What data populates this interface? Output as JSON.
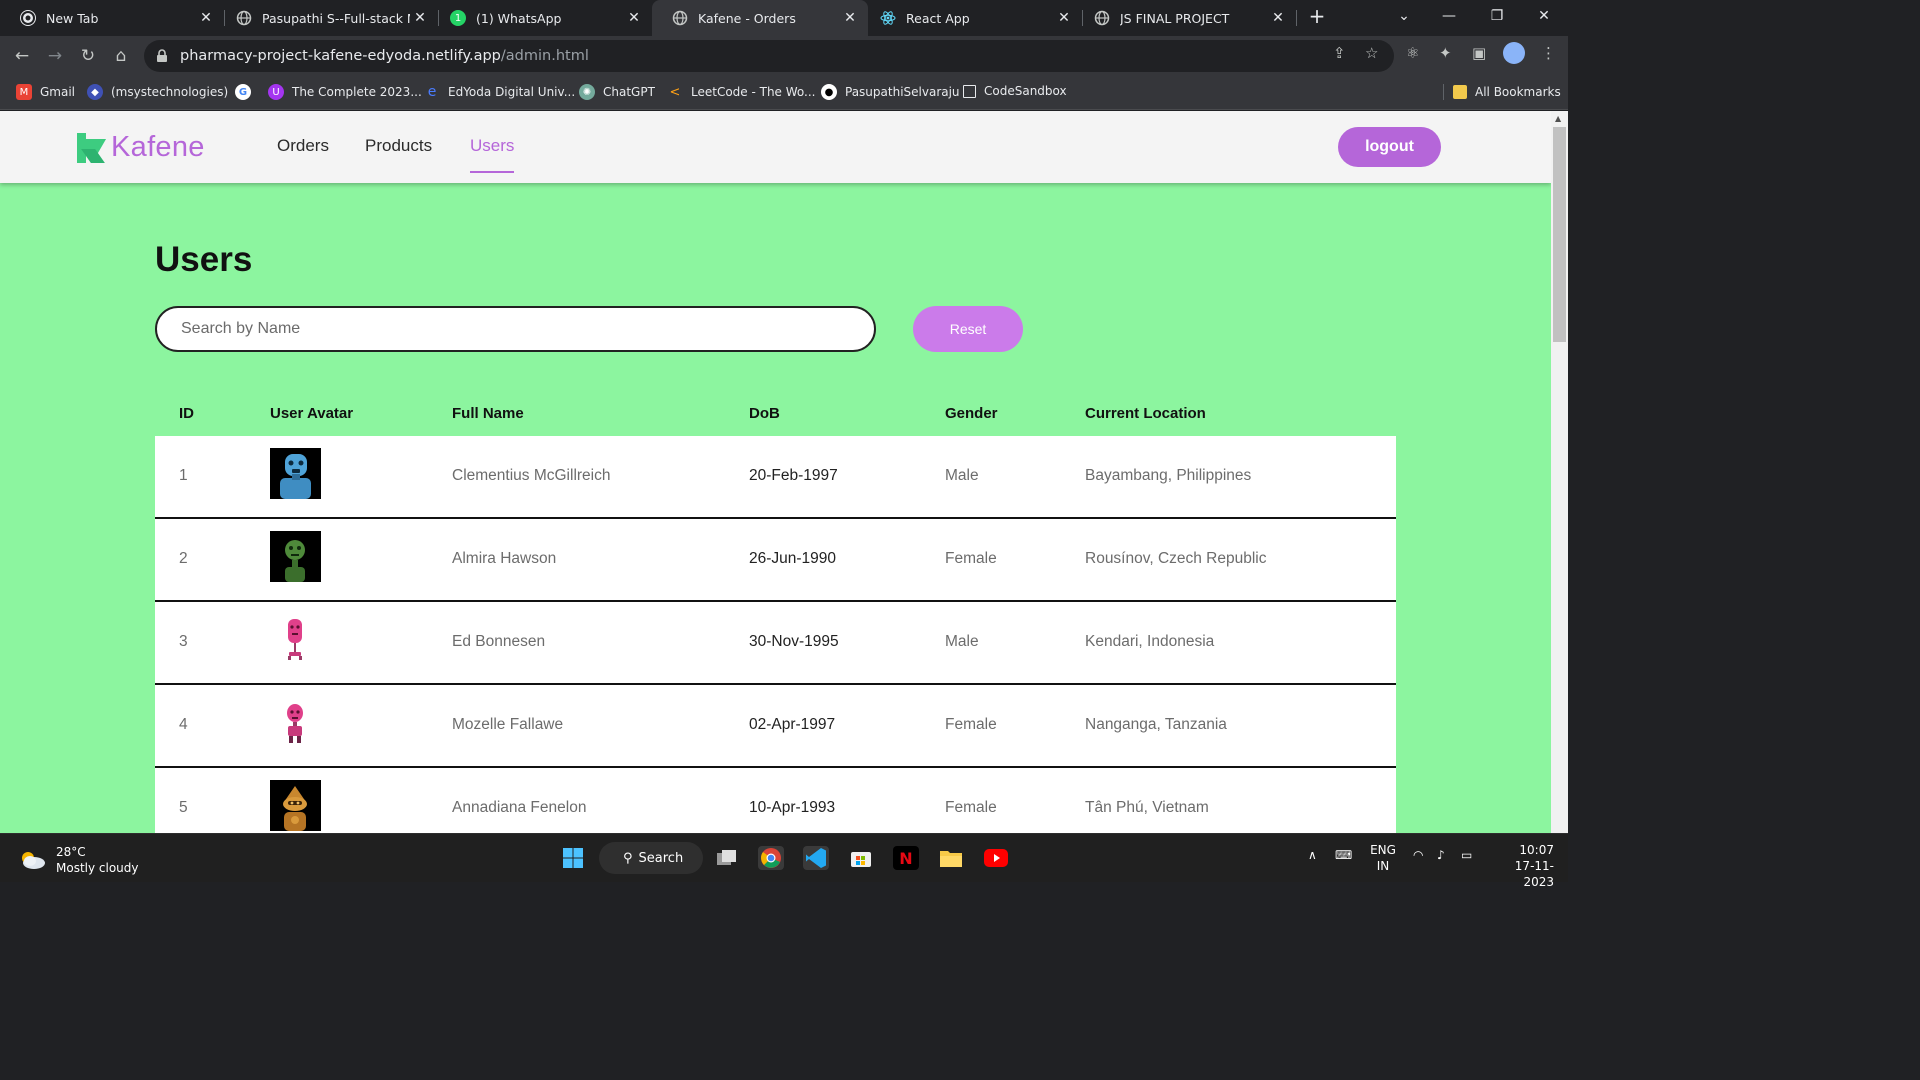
{
  "browser": {
    "tabs": [
      {
        "title": "New Tab"
      },
      {
        "title": "Pasupathi S--Full-stack ME"
      },
      {
        "title": "(1) WhatsApp"
      },
      {
        "title": "Kafene - Orders"
      },
      {
        "title": "React App"
      },
      {
        "title": "JS FINAL PROJECT"
      }
    ],
    "url_host": "pharmacy-project-kafene-edyoda.netlify.app",
    "url_path": "/admin.html",
    "bookmarks": [
      {
        "label": "Gmail"
      },
      {
        "label": "(msystechnologies)"
      },
      {
        "label": "The Complete 2023..."
      },
      {
        "label": "EdYoda Digital Univ..."
      },
      {
        "label": "ChatGPT"
      },
      {
        "label": "LeetCode - The Wo..."
      },
      {
        "label": "PasupathiSelvaraju"
      },
      {
        "label": "CodeSandbox"
      }
    ],
    "all_bookmarks": "All Bookmarks"
  },
  "app": {
    "brand": "Kafene",
    "nav": {
      "orders": "Orders",
      "products": "Products",
      "users": "Users"
    },
    "logout_label": "logout",
    "page_title": "Users",
    "search_placeholder": "Search by Name",
    "reset_label": "Reset",
    "columns": [
      "ID",
      "User Avatar",
      "Full Name",
      "DoB",
      "Gender",
      "Current Location"
    ],
    "users": [
      {
        "id": "1",
        "name": "Clementius McGillreich",
        "dob": "20-Feb-1997",
        "gender": "Male",
        "location": "Bayambang, Philippines",
        "avatar": "blue-robot"
      },
      {
        "id": "2",
        "name": "Almira Hawson",
        "dob": "26-Jun-1990",
        "gender": "Female",
        "location": "Rousínov, Czech Republic",
        "avatar": "green-robot"
      },
      {
        "id": "3",
        "name": "Ed Bonnesen",
        "dob": "30-Nov-1995",
        "gender": "Male",
        "location": "Kendari, Indonesia",
        "avatar": "pink-robot"
      },
      {
        "id": "4",
        "name": "Mozelle Fallawe",
        "dob": "02-Apr-1997",
        "gender": "Female",
        "location": "Nanganga, Tanzania",
        "avatar": "pink-robot"
      },
      {
        "id": "5",
        "name": "Annadiana Fenelon",
        "dob": "10-Apr-1993",
        "gender": "Female",
        "location": "Tân Phú, Vietnam",
        "avatar": "orange-robot"
      }
    ],
    "colors": {
      "accent": "#b566d9",
      "page_bg": "#8cf59f",
      "brand_green": "#3dcc80"
    }
  },
  "taskbar": {
    "temp": "28°C",
    "weather": "Mostly cloudy",
    "search_label": "Search",
    "lang": "ENG",
    "region": "IN",
    "time": "10:07",
    "date": "17-11-2023"
  }
}
